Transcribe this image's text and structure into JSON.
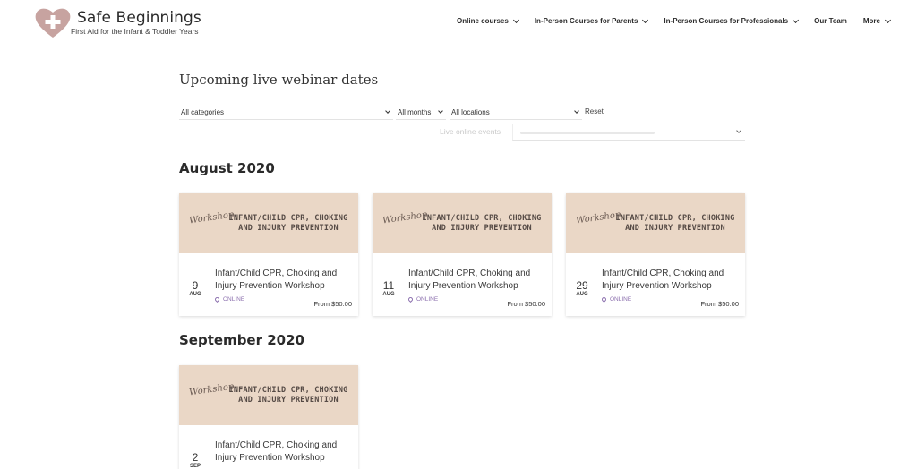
{
  "brand": {
    "title": "Safe Beginnings",
    "subtitle": "First Aid for the Infant & Toddler Years",
    "heart_color": "#c7a3a0"
  },
  "nav": [
    {
      "label": "Online courses",
      "dropdown": true
    },
    {
      "label": "In-Person Courses for Parents",
      "dropdown": true
    },
    {
      "label": "In-Person Courses for Professionals",
      "dropdown": true
    },
    {
      "label": "Our Team",
      "dropdown": false
    },
    {
      "label": "More",
      "dropdown": true
    }
  ],
  "page_title": "Upcoming live webinar dates",
  "filters": {
    "category": "All categories",
    "month": "All months",
    "location": "All locations",
    "reset": "Reset",
    "live_label": "Live online events"
  },
  "months": [
    {
      "heading": "August 2020",
      "events": [
        {
          "day": "9",
          "mon": "AUG",
          "title": "Infant/Child CPR, Choking and Injury Prevention Workshop",
          "location": "ONLINE",
          "price": "From $50.00",
          "banner_script": "Workshop",
          "banner_text": "INFANT/CHILD CPR, CHOKING AND INJURY PREVENTION"
        },
        {
          "day": "11",
          "mon": "AUG",
          "title": "Infant/Child CPR, Choking and Injury Prevention Workshop",
          "location": "ONLINE",
          "price": "From $50.00",
          "banner_script": "Workshop",
          "banner_text": "INFANT/CHILD CPR, CHOKING AND INJURY PREVENTION"
        },
        {
          "day": "29",
          "mon": "AUG",
          "title": "Infant/Child CPR, Choking and Injury Prevention Workshop",
          "location": "ONLINE",
          "price": "From $50.00",
          "banner_script": "Workshop",
          "banner_text": "INFANT/CHILD CPR, CHOKING AND INJURY PREVENTION"
        }
      ]
    },
    {
      "heading": "September 2020",
      "events": [
        {
          "day": "2",
          "mon": "SEP",
          "title": "Infant/Child CPR, Choking and Injury Prevention Workshop",
          "location": "",
          "price": "",
          "banner_script": "Workshop",
          "banner_text": "INFANT/CHILD CPR, CHOKING AND INJURY PREVENTION"
        }
      ]
    }
  ],
  "colors": {
    "banner_bg": "#ead7c6",
    "location_accent": "#8b6fae"
  }
}
